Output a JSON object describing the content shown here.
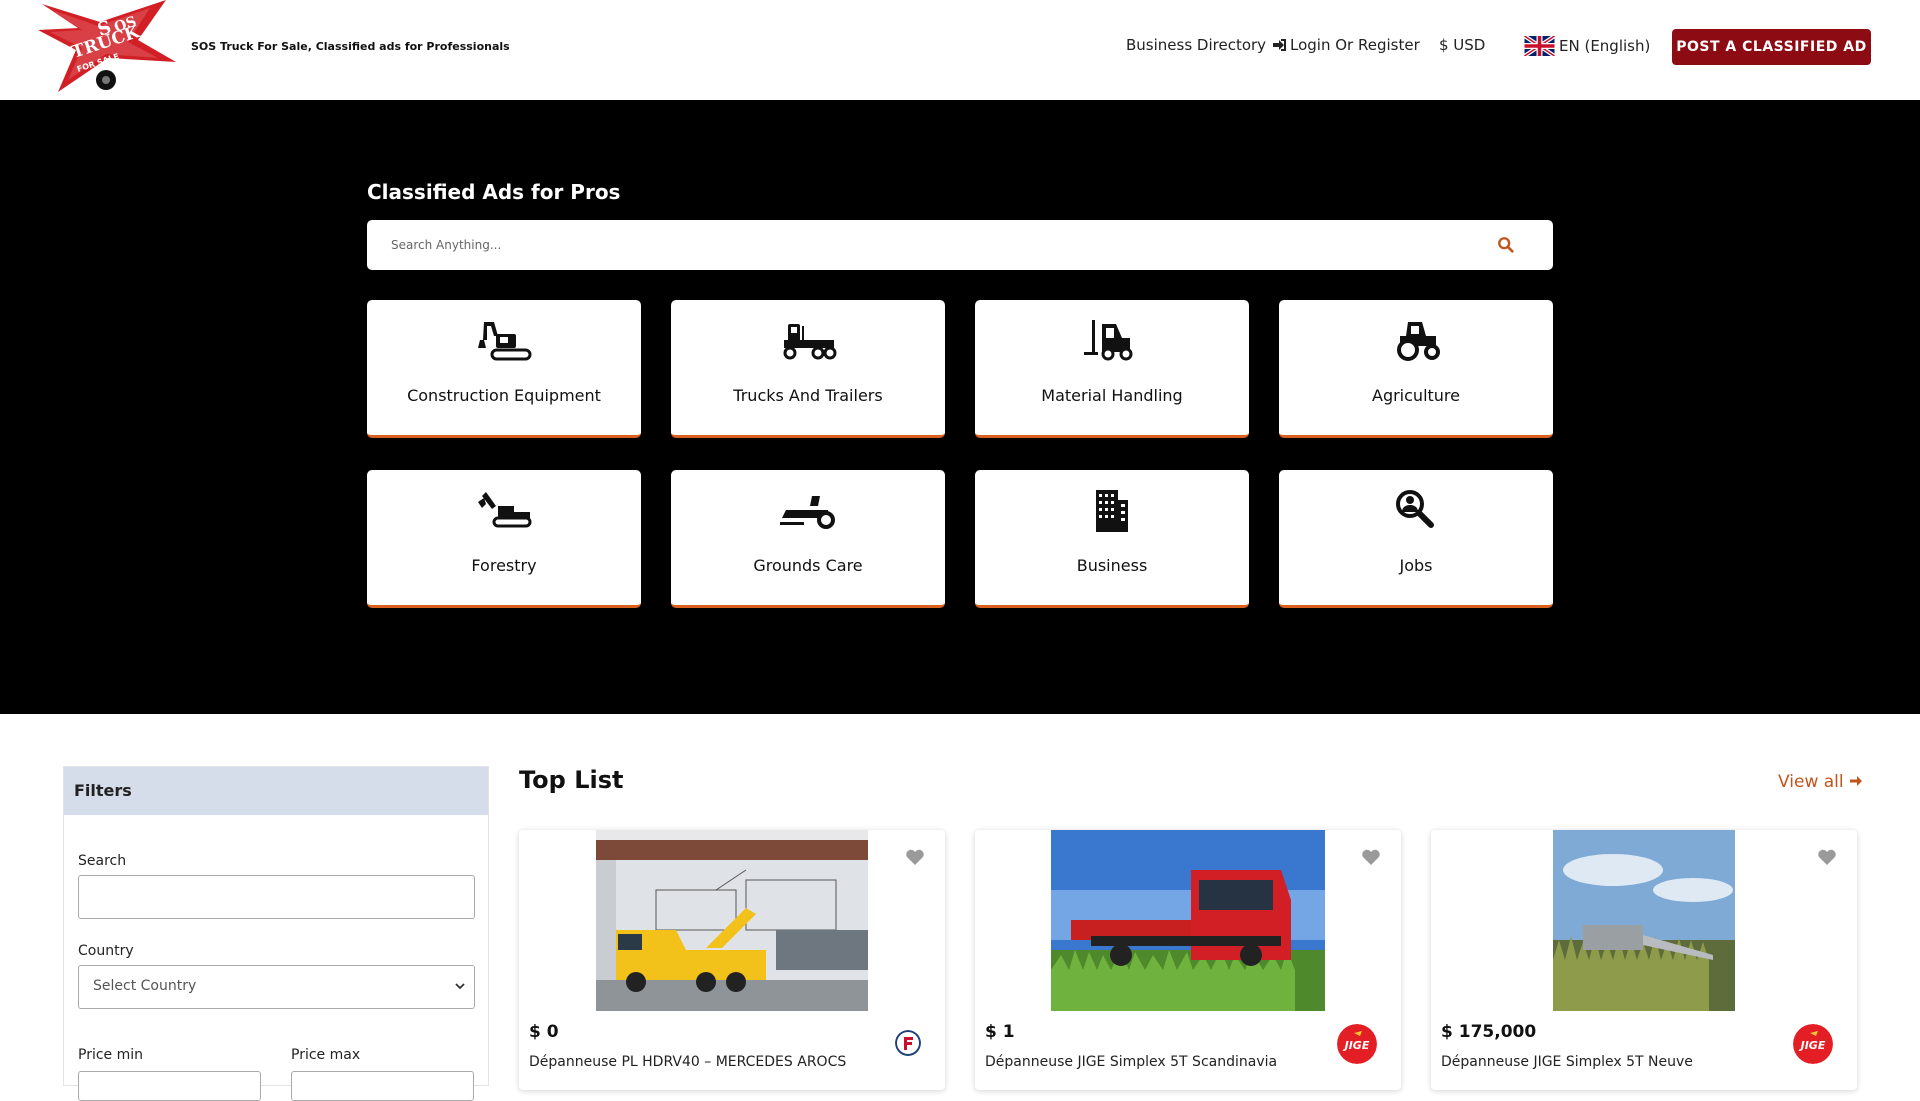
{
  "header": {
    "logo_text": "SOS TRUCK FOR SALE",
    "tagline": "SOS Truck For Sale, Classified ads for Professionals",
    "nav": {
      "directory": "Business Directory",
      "login": "Login Or Register",
      "currency": "$ USD",
      "language": "EN (English)"
    },
    "post_button": "POST A CLASSIFIED AD"
  },
  "hero": {
    "title": "Classified Ads for Pros",
    "search_placeholder": "Search Anything..."
  },
  "categories": [
    {
      "label": "Construction Equipment",
      "icon": "excavator-icon"
    },
    {
      "label": "Trucks And Trailers",
      "icon": "truck-trailer-icon"
    },
    {
      "label": "Material Handling",
      "icon": "forklift-icon"
    },
    {
      "label": "Agriculture",
      "icon": "tractor-icon"
    },
    {
      "label": "Forestry",
      "icon": "forestry-machine-icon"
    },
    {
      "label": "Grounds Care",
      "icon": "lawn-mower-icon"
    },
    {
      "label": "Business",
      "icon": "building-icon"
    },
    {
      "label": "Jobs",
      "icon": "job-search-icon"
    }
  ],
  "filters": {
    "title": "Filters",
    "search_label": "Search",
    "country_label": "Country",
    "country_value": "Select Country",
    "price_min_label": "Price min",
    "price_max_label": "Price max"
  },
  "toplist": {
    "title": "Top List",
    "view_all": "View all",
    "items": [
      {
        "price": "$  0",
        "title": "Dépanneuse PL HDRV40 – MERCEDES AROCS",
        "badge_color": "#1f3f7a"
      },
      {
        "price": "$  1",
        "title": "Dépanneuse JIGE Simplex 5T Scandinavia",
        "badge_text": "JIGE",
        "badge_color": "#e31e24"
      },
      {
        "price": "$  175,000",
        "title": "Dépanneuse JIGE Simplex 5T Neuve",
        "badge_text": "JIGE",
        "badge_color": "#e31e24"
      }
    ]
  },
  "colors": {
    "accent": "#8d0b12",
    "orange": "#d9601f",
    "hero_bg": "#000000",
    "filter_head_bg": "#d5dcea"
  }
}
